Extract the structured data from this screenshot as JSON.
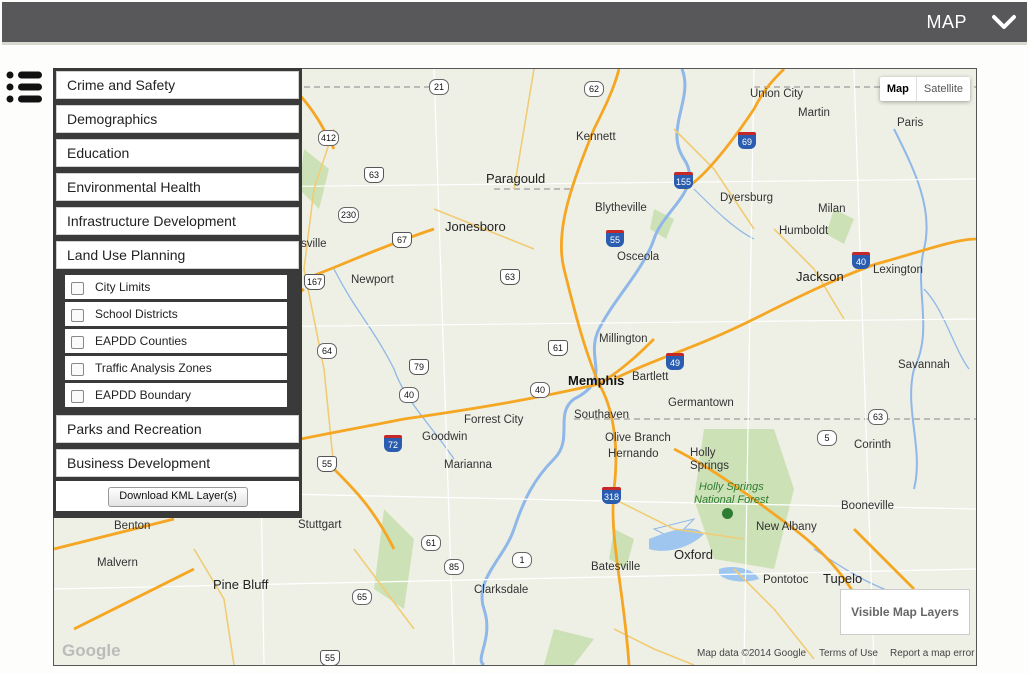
{
  "header": {
    "title": "MAP"
  },
  "icons": {
    "chevron": "chevron-down-icon",
    "menu": "list-menu-icon",
    "interstate": "interstate-shield-icon",
    "us_route": "us-route-shield-icon",
    "state_route": "state-route-shield-icon",
    "recreation": "recreation-area-icon"
  },
  "map_controls": {
    "map_label": "Map",
    "satellite_label": "Satellite"
  },
  "categories": [
    {
      "label": "Crime and Safety"
    },
    {
      "label": "Demographics"
    },
    {
      "label": "Education"
    },
    {
      "label": "Environmental Health"
    },
    {
      "label": "Infrastructure Development"
    },
    {
      "label": "Land Use Planning"
    },
    {
      "label": "Parks and Recreation"
    },
    {
      "label": "Business Development"
    }
  ],
  "land_use_layers": [
    {
      "label": "City Limits",
      "checked": false
    },
    {
      "label": "School Districts",
      "checked": false
    },
    {
      "label": "EAPDD Counties",
      "checked": false
    },
    {
      "label": "Traffic Analysis Zones",
      "checked": false
    },
    {
      "label": "EAPDD Boundary",
      "checked": false
    }
  ],
  "download_label": "Download KML Layer(s)",
  "visible_layers_label": "Visible Map Layers",
  "map_cities": {
    "union_city": "Union City",
    "martin": "Martin",
    "paris": "Paris",
    "kennett": "Kennett",
    "paragould": "Paragould",
    "blytheville": "Blytheville",
    "dyersburg": "Dyersburg",
    "milan": "Milan",
    "humboldt": "Humboldt",
    "jonesboro": "Jonesboro",
    "osceola": "Osceola",
    "jackson": "Jackson",
    "lexington": "Lexington",
    "newport": "Newport",
    "sville": "sville",
    "millington": "Millington",
    "memphis": "Memphis",
    "bartlett": "Bartlett",
    "germantown": "Germantown",
    "savannah": "Savannah",
    "southaven": "Southaven",
    "forrest_city": "Forrest City",
    "goodwin": "Goodwin",
    "olive_branch": "Olive Branch",
    "corinth": "Corinth",
    "hernando": "Hernando",
    "holly_springs": "Holly\nSprings",
    "marianna": "Marianna",
    "benton": "Benton",
    "stuttgart": "Stuttgart",
    "booneville": "Booneville",
    "new_albany": "New Albany",
    "malvern": "Malvern",
    "oxford": "Oxford",
    "batesville": "Batesville",
    "pine_bluff": "Pine Bluff",
    "pontotoc": "Pontotoc",
    "tupelo": "Tupelo",
    "clarksdale": "Clarksdale"
  },
  "park_label": "Holly Springs\nNational Forest",
  "route_shields": [
    "21",
    "62",
    "412",
    "69",
    "63",
    "155",
    "230",
    "67",
    "55",
    "40",
    "167",
    "63",
    "61",
    "64",
    "79",
    "40",
    "49",
    "40",
    "72",
    "5",
    "63",
    "55",
    "318",
    "61",
    "85",
    "1",
    "65",
    "55"
  ],
  "footer": {
    "map_data": "Map data ©2014 Google",
    "terms": "Terms of Use",
    "report": "Report a map error",
    "logo": "Google"
  }
}
